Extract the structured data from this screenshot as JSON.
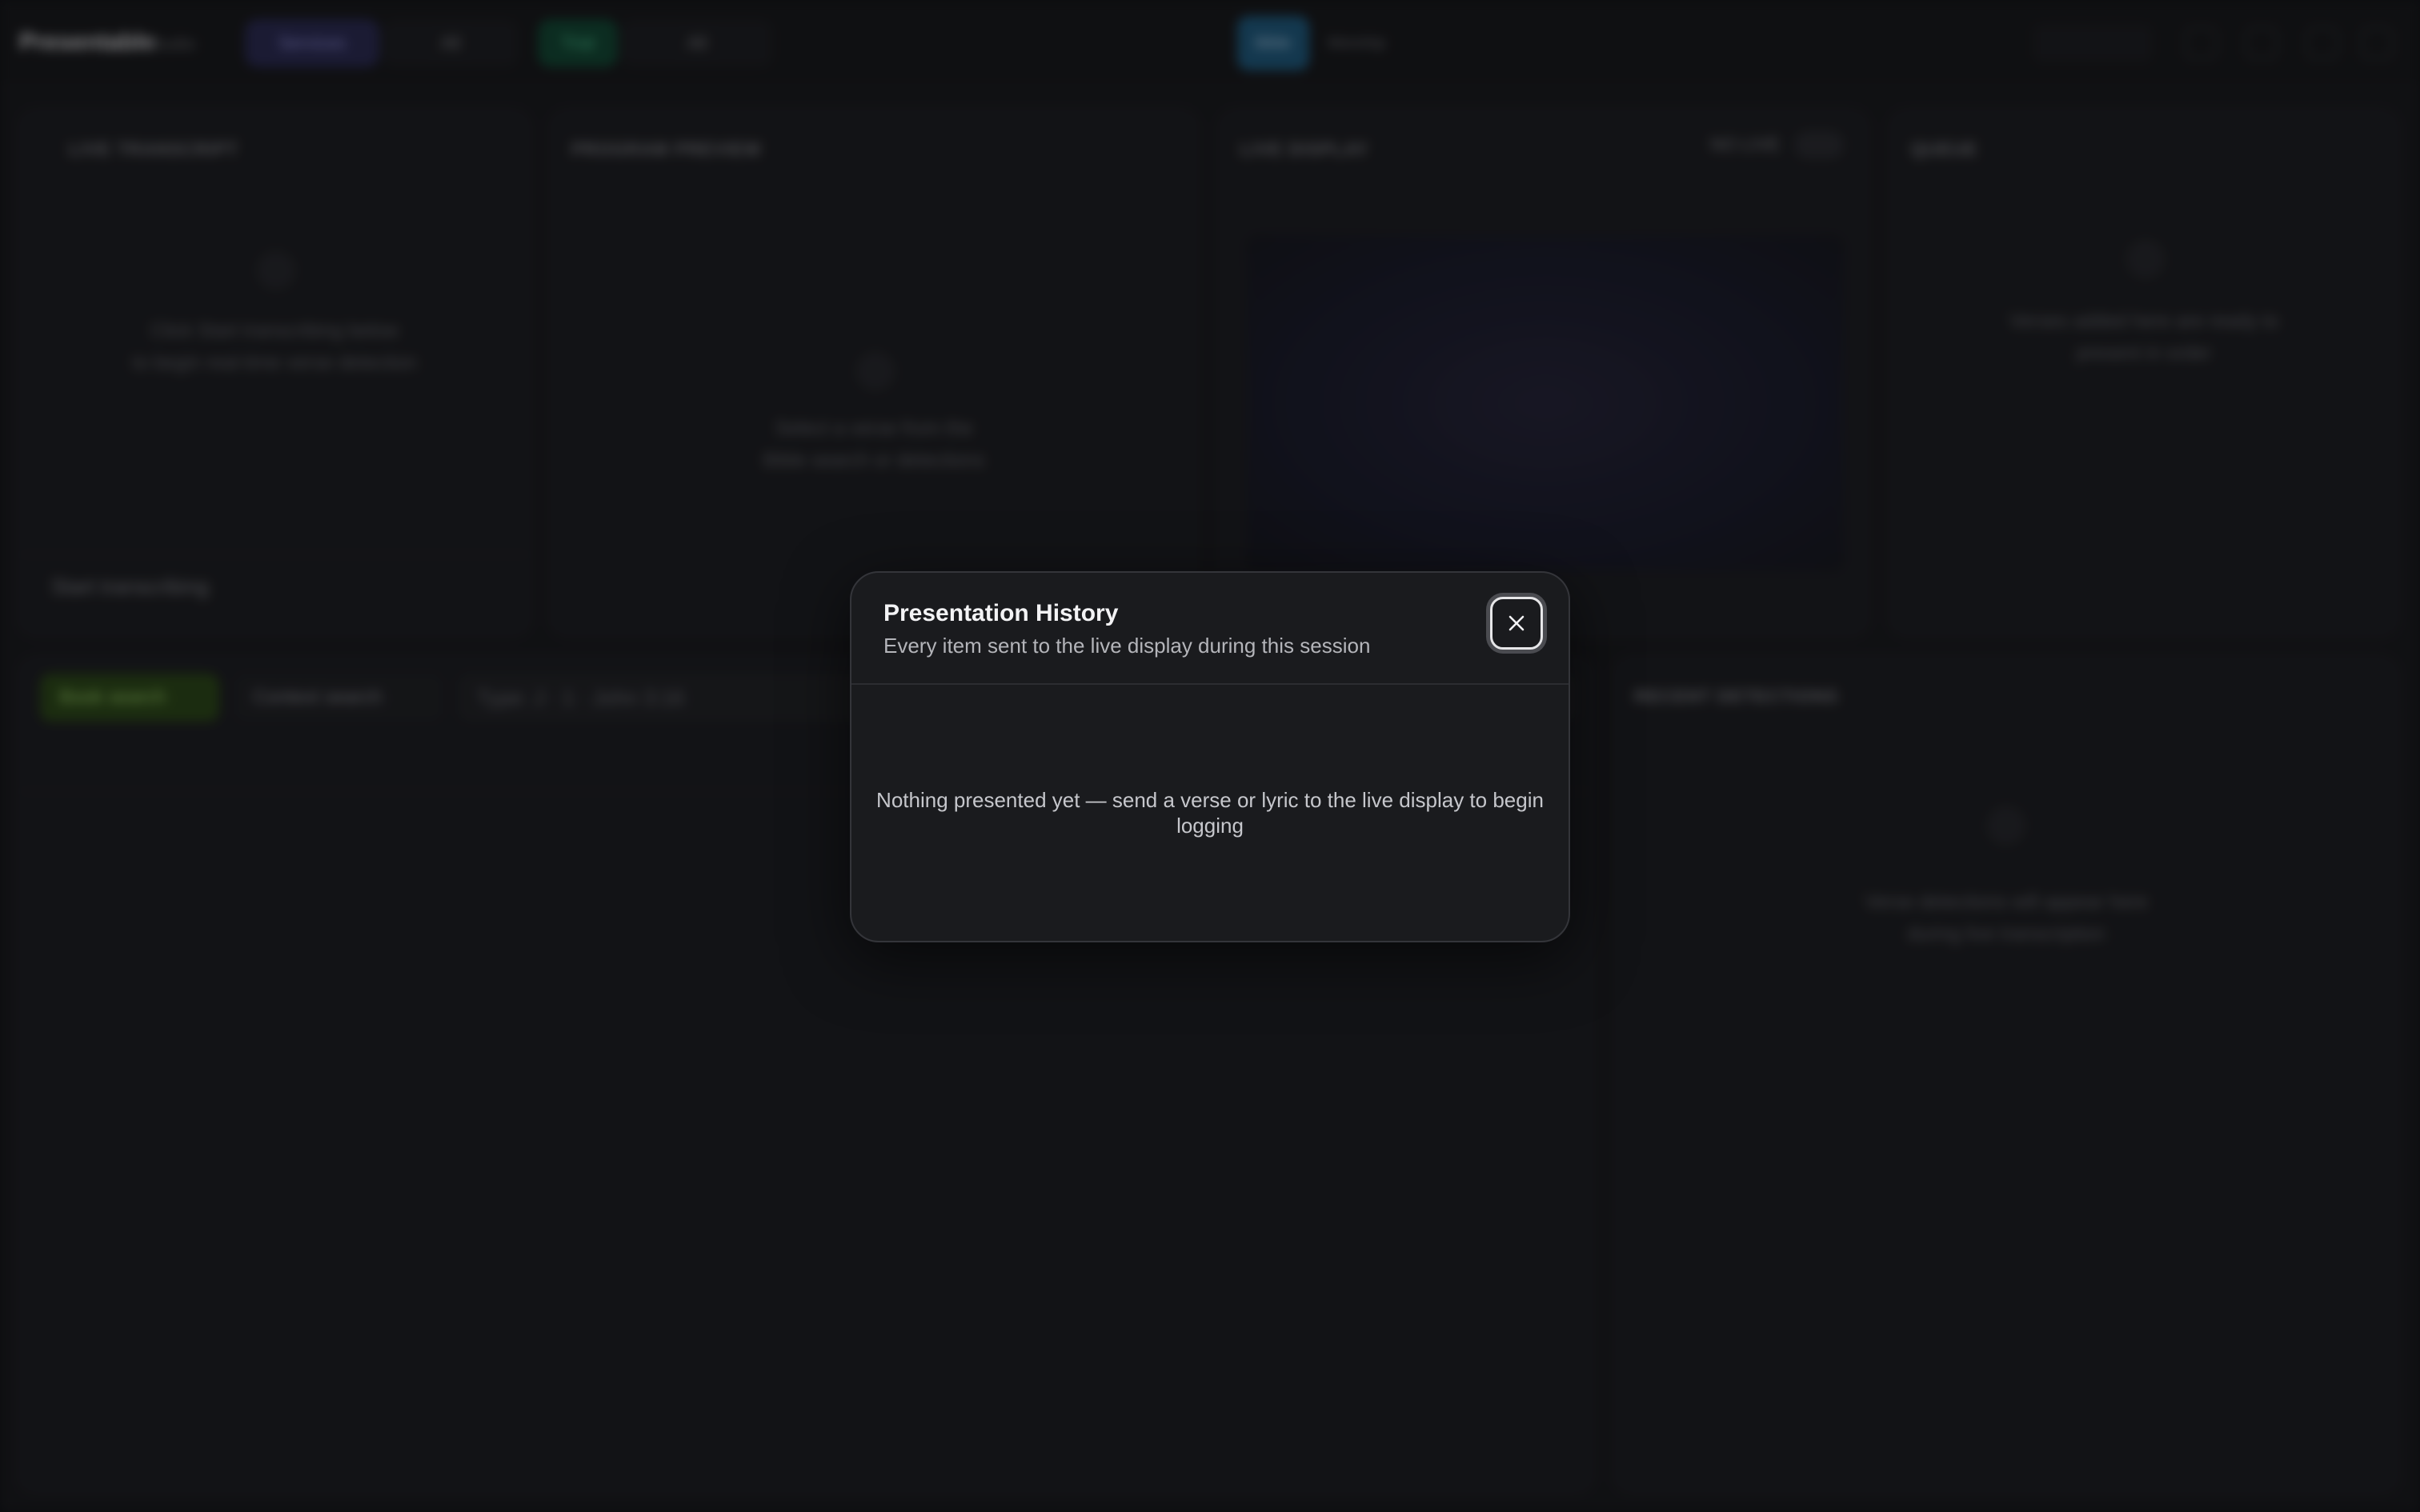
{
  "app": {
    "brand": "Presentable",
    "brand_sub": "Studio",
    "services_label": "Services",
    "services_value": "All",
    "trial_label": "Trial",
    "trial_value": "All",
    "nav": [
      "",
      "Bible",
      "Worship",
      "",
      ""
    ],
    "accent": "#1d5f86"
  },
  "panels": {
    "transcript": {
      "title": "LIVE TRANSCRIPT",
      "hint_line1": "Click Start transcribing below",
      "hint_line2": "to begin real-time verse detection",
      "start_label": "Start transcribing"
    },
    "preview": {
      "title": "PROGRAM PREVIEW",
      "hint_line1": "Select a verse from the",
      "hint_line2": "Bible search or detections"
    },
    "live": {
      "title": "LIVE DISPLAY",
      "badge": "NO LIVE"
    },
    "queue": {
      "title": "QUEUE",
      "hint_line1": "Verses added here are ready to",
      "hint_line2": "present in order"
    },
    "search": {
      "book_tab": "Book search",
      "context_tab": "Context search",
      "input_placeholder": "Type: J · 1 · John 3:16"
    },
    "detections": {
      "title": "RECENT DETECTIONS",
      "hint_line1": "Verse detections will appear here",
      "hint_line2": "during live transcription"
    }
  },
  "modal": {
    "title": "Presentation History",
    "subtitle": "Every item sent to the live display during this session",
    "empty_message": "Nothing presented yet — send a verse or lyric to the live display to begin logging",
    "close_icon": "close-icon"
  }
}
